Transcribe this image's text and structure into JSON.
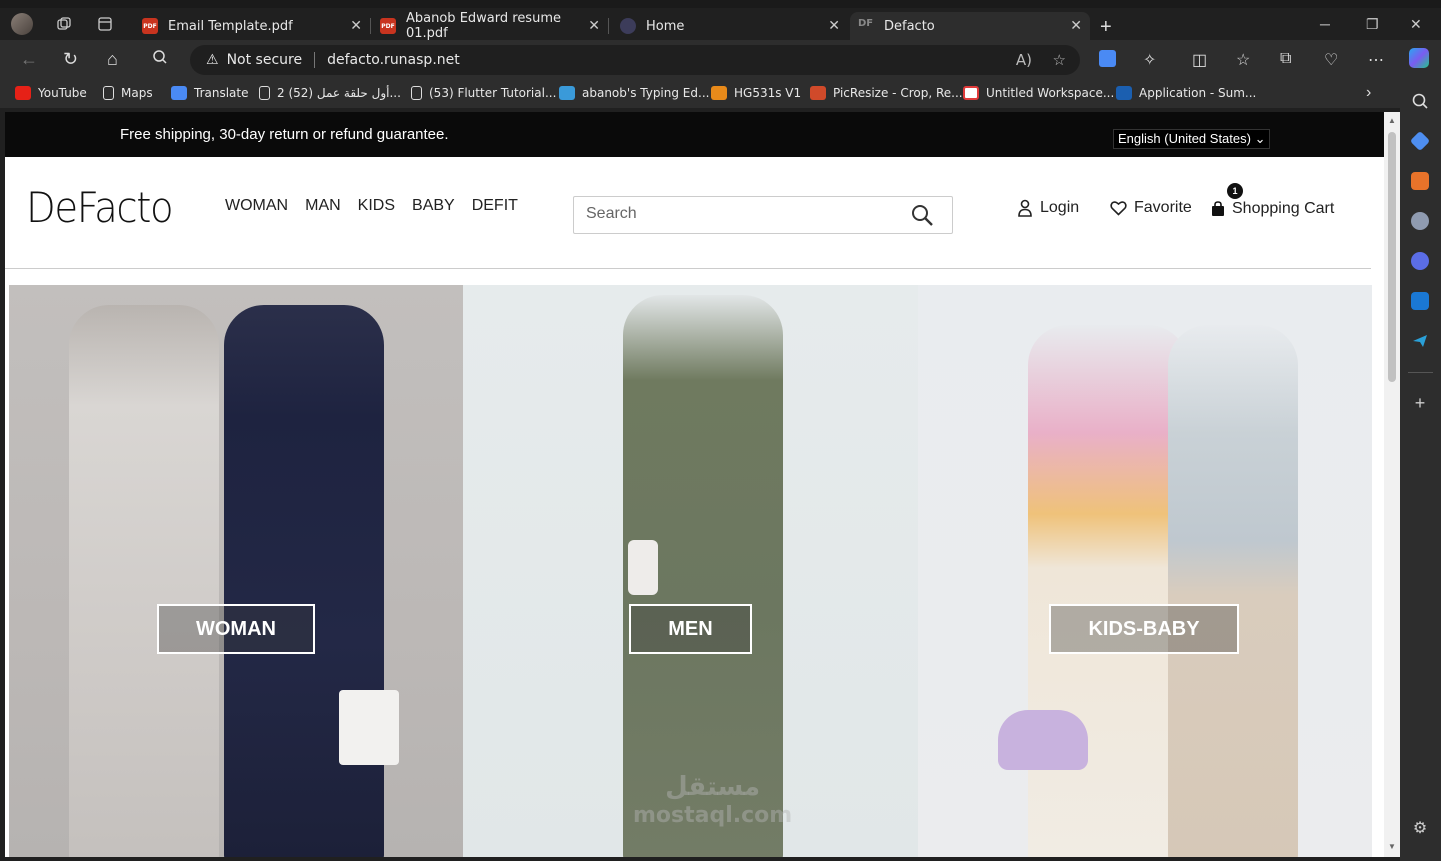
{
  "browser": {
    "tabs": [
      {
        "title": "Email Template.pdf",
        "favicon": "pdf-icon"
      },
      {
        "title": "Abanob Edward resume 01.pdf",
        "favicon": "pdf-icon"
      },
      {
        "title": "Home",
        "favicon": "site-icon"
      },
      {
        "title": "Defacto",
        "favicon": "df-icon",
        "active": true
      }
    ],
    "address": {
      "security": "Not secure",
      "url": "defacto.runasp.net"
    },
    "bookmarks": [
      {
        "label": "YouTube",
        "color": "#e62117"
      },
      {
        "label": "Maps",
        "color": "#dddddd"
      },
      {
        "label": "Translate",
        "color": "#4a8af4"
      },
      {
        "label": "2 (52) أول حلقة عمل...",
        "color": "#dddddd"
      },
      {
        "label": "(53) Flutter Tutorial...",
        "color": "#dddddd"
      },
      {
        "label": "abanob's Typing Ed...",
        "color": "#3a9ad9"
      },
      {
        "label": "HG531s V1",
        "color": "#e88a1a"
      },
      {
        "label": "PicResize - Crop, Re...",
        "color": "#d04a2a"
      },
      {
        "label": "Untitled Workspace...",
        "color": "#e03a3a"
      },
      {
        "label": "Application - Sum...",
        "color": "#1b5fb0"
      }
    ]
  },
  "site": {
    "announcement": "Free shipping, 30-day return or refund guarantee.",
    "language": "English (United States)",
    "logo": "DeFacto",
    "nav": [
      "WOMAN",
      "MAN",
      "KIDS",
      "BABY",
      "DEFIT"
    ],
    "search_placeholder": "Search",
    "login": "Login",
    "favorite": "Favorite",
    "cart": "Shopping Cart",
    "cart_count": "1",
    "hero": [
      {
        "label": "WOMAN"
      },
      {
        "label": "MEN"
      },
      {
        "label": "KIDS-BABY"
      }
    ],
    "watermark": {
      "arabic": "مستقل",
      "latin": "mostaql.com"
    }
  }
}
